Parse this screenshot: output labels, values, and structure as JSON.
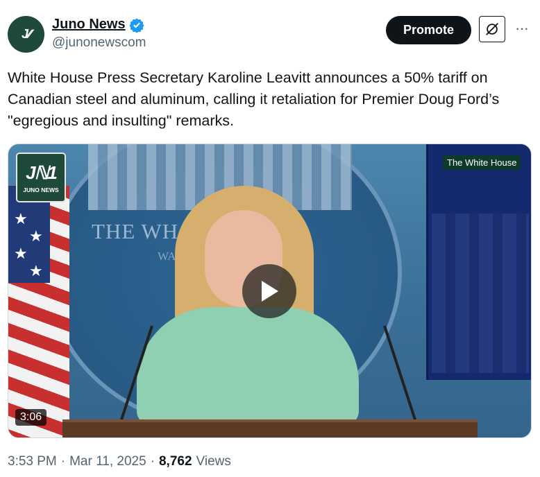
{
  "author": {
    "avatar_text": "J∕∕",
    "display_name": "Juno News",
    "handle": "@junonewscom",
    "verified": true
  },
  "actions": {
    "promote_label": "Promote",
    "grok_icon": "grok-icon",
    "more_icon": "···"
  },
  "tweet": {
    "text": "White House Press Secretary Karoline Leavitt announces a 50% tariff on Canadian steel and aluminum, calling it retaliation for Premier Doug Ford’s \"egregious and insulting\" remarks."
  },
  "media": {
    "logo_mark": "Jℕ1",
    "logo_text": "JUNO NEWS",
    "seal_text": "THE WH     OUSE",
    "seal_sub": "WA",
    "corner_badge": "The White House",
    "duration": "3:06",
    "play_icon": "play-icon"
  },
  "meta": {
    "time": "3:53 PM",
    "sep1": "·",
    "date": "Mar 11, 2025",
    "sep2": "·",
    "views_count": "8,762",
    "views_label": "Views"
  },
  "colors": {
    "brand_green": "#1f4a3a",
    "verified_blue": "#1d9bf0",
    "text_primary": "#0f1419",
    "text_secondary": "#536471"
  }
}
